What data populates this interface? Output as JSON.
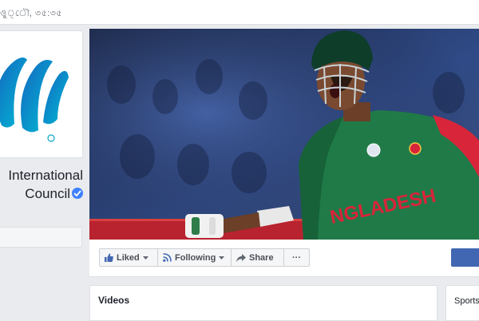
{
  "topbar": {
    "fragment_text": "ও‌ু‌্‌‌ৌ, ৩৫‌:‌৩৫"
  },
  "page": {
    "name_line1": "International",
    "name_line2": "Council"
  },
  "cover": {
    "shirt_text": "NGLADESH"
  },
  "actions": {
    "liked_label": "Liked",
    "following_label": "Following",
    "share_label": "Share",
    "more_label": "···"
  },
  "sections": {
    "videos_title": "Videos",
    "sports_title": "Sports"
  },
  "colors": {
    "brand_blue": "#4267b2",
    "verified_blue": "#4080ff",
    "jersey_green": "#1f7a48",
    "jersey_red": "#d8253a",
    "logo_teal": "#0aa5c6"
  }
}
